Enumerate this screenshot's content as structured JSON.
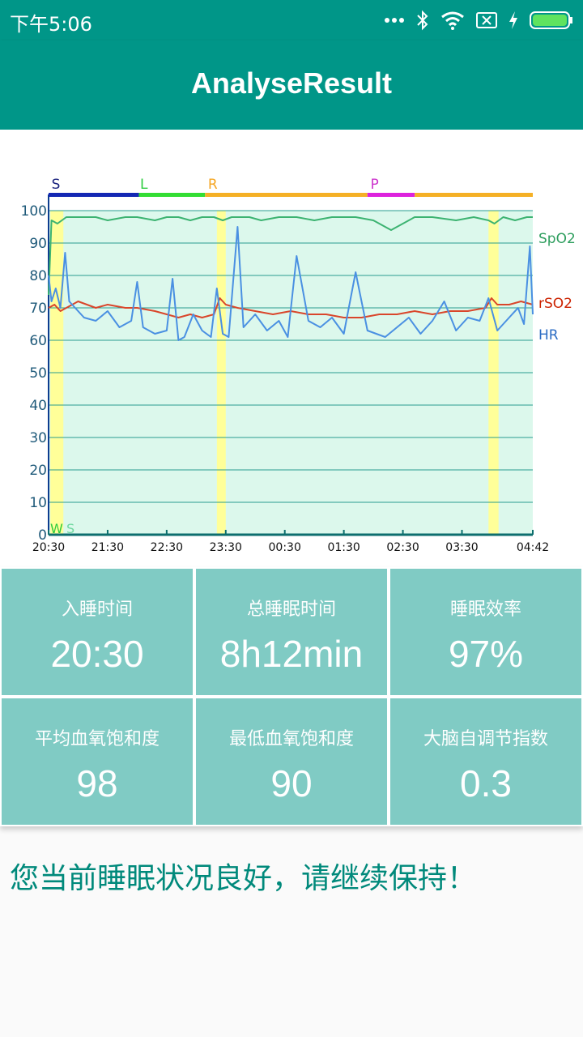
{
  "status_bar": {
    "time": "下午5:06",
    "icons": [
      "more-dots-icon",
      "bluetooth-icon",
      "wifi-icon",
      "sim-icon",
      "charging-icon",
      "battery-icon"
    ]
  },
  "app_bar": {
    "title": "AnalyseResult"
  },
  "colors": {
    "primary": "#009688",
    "tile": "#80cbc4",
    "message": "#00897b",
    "spo2": "#3cb371",
    "rso2": "#d9462b",
    "hr": "#4a90e2",
    "plot_bg": "#dcf8ec",
    "wake_highlight": "#ffff99"
  },
  "chart_data": {
    "type": "line",
    "ylim": [
      0,
      100
    ],
    "y_ticks": [
      "0",
      "10",
      "20",
      "30",
      "40",
      "50",
      "60",
      "70",
      "80",
      "90",
      "100"
    ],
    "x_ticks": [
      "20:30",
      "21:30",
      "22:30",
      "23:30",
      "00:30",
      "01:30",
      "02:30",
      "03:30",
      "04:42"
    ],
    "x_tick_hours": [
      0,
      1,
      2,
      3,
      4,
      5,
      6,
      7,
      8.2
    ],
    "x_range_hours": [
      0,
      8.2
    ],
    "stage_bar": {
      "labels": [
        {
          "text": "S",
          "at": 0.05,
          "color": "#1a237e"
        },
        {
          "text": "L",
          "at": 1.55,
          "color": "#2ecc40"
        },
        {
          "text": "R",
          "at": 2.7,
          "color": "#f5a623"
        },
        {
          "text": "P",
          "at": 5.45,
          "color": "#cc33cc"
        }
      ],
      "segments": [
        {
          "from": 0,
          "to": 1.53,
          "color": "#1428b4"
        },
        {
          "from": 1.53,
          "to": 2.65,
          "color": "#33dd33"
        },
        {
          "from": 2.65,
          "to": 5.4,
          "color": "#f5b025"
        },
        {
          "from": 5.4,
          "to": 6.2,
          "color": "#dd22dd"
        },
        {
          "from": 6.2,
          "to": 8.2,
          "color": "#f5b025"
        }
      ]
    },
    "wake_periods": [
      [
        0.03,
        0.25
      ],
      [
        2.85,
        3.0
      ],
      [
        7.45,
        7.62
      ]
    ],
    "bottom_label": {
      "w": "W",
      "s": "S"
    },
    "series": [
      {
        "name": "SpO2",
        "color": "#3cb371",
        "x": [
          0,
          0.05,
          0.15,
          0.3,
          0.5,
          0.8,
          1.0,
          1.3,
          1.5,
          1.8,
          2.0,
          2.2,
          2.4,
          2.6,
          2.8,
          2.95,
          3.1,
          3.4,
          3.6,
          3.9,
          4.2,
          4.5,
          4.8,
          5.2,
          5.5,
          5.8,
          6.2,
          6.5,
          6.9,
          7.2,
          7.45,
          7.55,
          7.7,
          7.9,
          8.1,
          8.2
        ],
        "y": [
          74,
          97,
          96,
          98,
          98,
          98,
          97,
          98,
          98,
          97,
          98,
          98,
          97,
          98,
          98,
          97,
          98,
          98,
          97,
          98,
          98,
          97,
          98,
          98,
          97,
          94,
          98,
          98,
          97,
          98,
          97,
          96,
          98,
          97,
          98,
          98
        ]
      },
      {
        "name": "rSO2",
        "color": "#d9462b",
        "x": [
          0,
          0.1,
          0.2,
          0.3,
          0.5,
          0.8,
          1.0,
          1.3,
          1.5,
          1.8,
          2.0,
          2.2,
          2.4,
          2.6,
          2.8,
          2.9,
          3.0,
          3.2,
          3.5,
          3.8,
          4.1,
          4.4,
          4.7,
          5.0,
          5.3,
          5.6,
          5.9,
          6.2,
          6.5,
          6.8,
          7.1,
          7.4,
          7.5,
          7.6,
          7.8,
          8.0,
          8.2
        ],
        "y": [
          70,
          71,
          69,
          70,
          72,
          70,
          71,
          70,
          70,
          69,
          68,
          67,
          68,
          67,
          68,
          73,
          71,
          70,
          69,
          68,
          69,
          68,
          68,
          67,
          67,
          68,
          68,
          69,
          68,
          69,
          69,
          70,
          73,
          71,
          71,
          72,
          71
        ]
      },
      {
        "name": "HR",
        "color": "#4a90e2",
        "x": [
          0,
          0.05,
          0.12,
          0.2,
          0.28,
          0.35,
          0.45,
          0.6,
          0.8,
          1.0,
          1.2,
          1.4,
          1.5,
          1.6,
          1.8,
          2.0,
          2.1,
          2.2,
          2.3,
          2.45,
          2.6,
          2.75,
          2.85,
          2.95,
          3.05,
          3.2,
          3.3,
          3.5,
          3.7,
          3.9,
          4.05,
          4.2,
          4.4,
          4.6,
          4.8,
          5.0,
          5.2,
          5.4,
          5.55,
          5.7,
          5.9,
          6.1,
          6.3,
          6.5,
          6.7,
          6.9,
          7.1,
          7.3,
          7.45,
          7.6,
          7.8,
          7.95,
          8.05,
          8.15,
          8.2
        ],
        "y": [
          80,
          72,
          76,
          70,
          87,
          72,
          70,
          67,
          66,
          69,
          64,
          66,
          78,
          64,
          62,
          63,
          79,
          60,
          61,
          68,
          63,
          61,
          76,
          62,
          61,
          95,
          64,
          68,
          63,
          66,
          61,
          86,
          66,
          64,
          67,
          62,
          81,
          63,
          62,
          61,
          64,
          67,
          62,
          66,
          72,
          63,
          67,
          66,
          73,
          63,
          67,
          70,
          65,
          89,
          68
        ]
      }
    ]
  },
  "stats": [
    {
      "label": "入睡时间",
      "value": "20:30"
    },
    {
      "label": "总睡眠时间",
      "value": "8h12min"
    },
    {
      "label": "睡眠效率",
      "value": "97%"
    },
    {
      "label": "平均血氧饱和度",
      "value": "98"
    },
    {
      "label": "最低血氧饱和度",
      "value": "90"
    },
    {
      "label": "大脑自调节指数",
      "value": "0.3"
    }
  ],
  "message": "您当前睡眠状况良好，请继续保持！"
}
